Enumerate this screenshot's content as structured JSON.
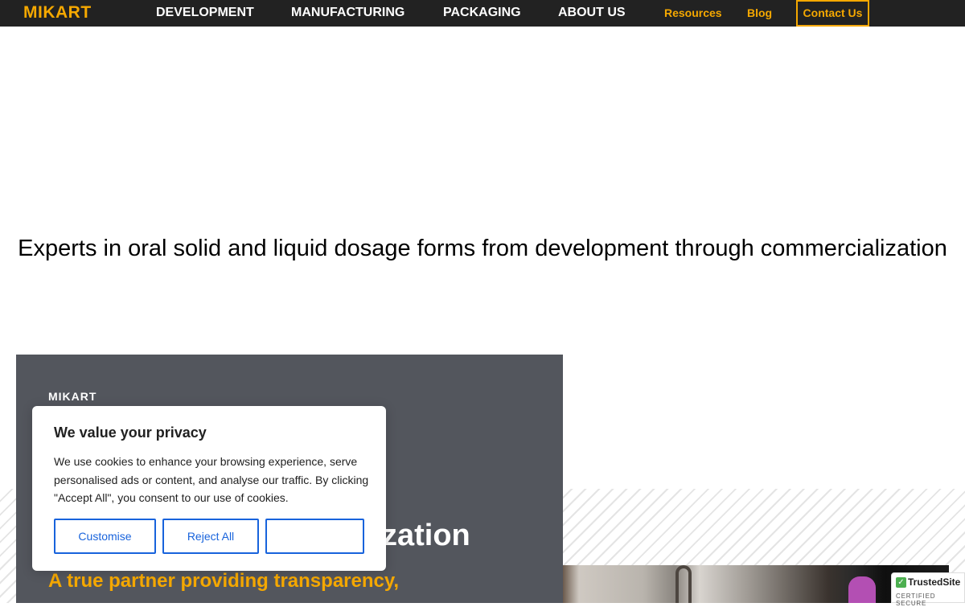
{
  "brand": {
    "logo": "MIKART",
    "accent_color": "#f5a800",
    "nav_bg": "#222222"
  },
  "nav": {
    "main": [
      {
        "label": "DEVELOPMENT"
      },
      {
        "label": "MANUFACTURING"
      },
      {
        "label": "PACKAGING"
      },
      {
        "label": "ABOUT US"
      }
    ],
    "secondary": [
      {
        "label": "Resources"
      },
      {
        "label": "Blog"
      }
    ],
    "contact_label": "Contact Us"
  },
  "tagline": "Experts in oral solid and liquid dosage forms from development through commercialization",
  "hero": {
    "brand": "MIKART",
    "heading_visible": "zation",
    "subheading": "A true partner providing transparency,",
    "bg_color": "#53565d"
  },
  "cookie": {
    "title": "We value your privacy",
    "text": "We use cookies to enhance your browsing experience, serve personalised ads or content, and analyse our traffic. By clicking \"Accept All\", you consent to our use of cookies.",
    "buttons": {
      "customise": "Customise",
      "reject": "Reject All",
      "accept": ""
    },
    "button_color": "#1863dc"
  },
  "trust_badge": {
    "name": "TrustedSite",
    "sub": "CERTIFIED SECURE",
    "icon": "check-icon"
  }
}
